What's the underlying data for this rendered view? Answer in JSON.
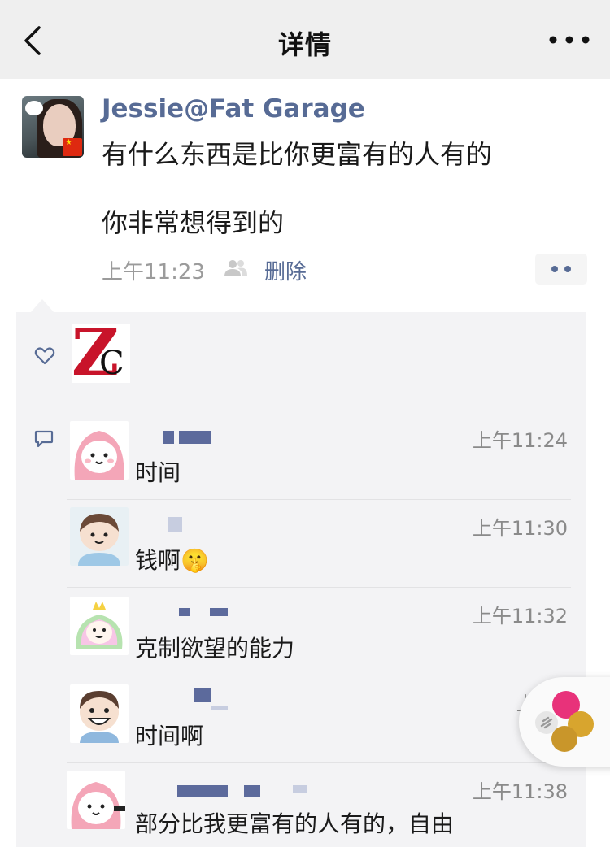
{
  "nav": {
    "title": "详情"
  },
  "post": {
    "username": "Jessie@Fat Garage",
    "content_line1": "有什么东西是比你更富有的人有的",
    "content_line2": "你非常想得到的",
    "time": "上午11:23",
    "delete_label": "删除"
  },
  "comments": [
    {
      "name": "",
      "time": "上午11:24",
      "text": "时间"
    },
    {
      "name": "",
      "time": "上午11:30",
      "text": "钱啊🤫"
    },
    {
      "name": "",
      "time": "上午11:32",
      "text": "克制欲望的能力"
    },
    {
      "name": "",
      "time": "上午1",
      "text": "时间啊"
    },
    {
      "name": "",
      "time": "上午11:38",
      "text": "部分比我更富有的人有的，自由"
    }
  ],
  "colors": {
    "link": "#576b95",
    "panel_bg": "#f3f3f5",
    "nav_bg": "#efefef"
  }
}
